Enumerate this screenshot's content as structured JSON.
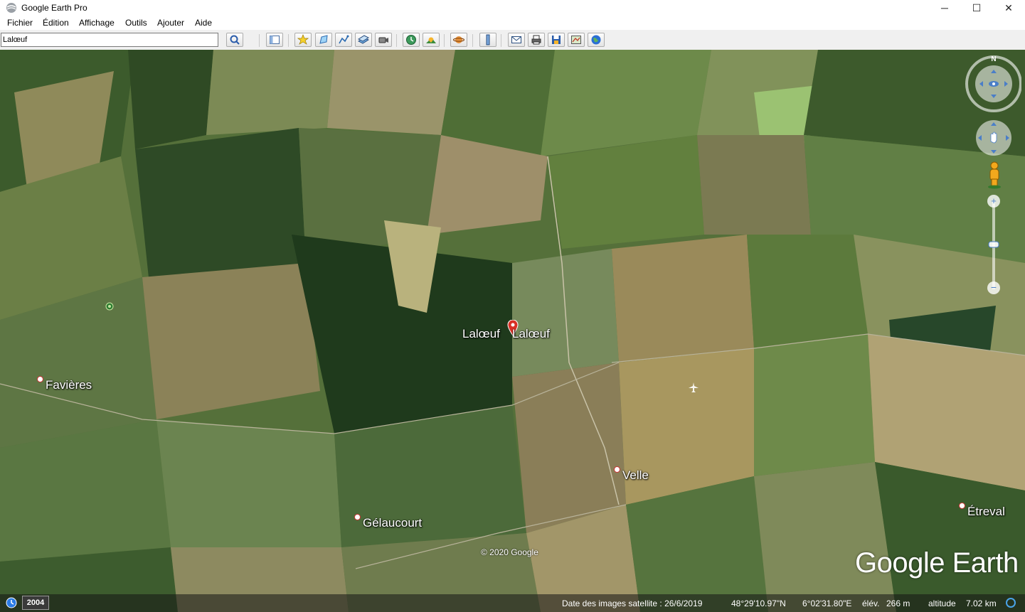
{
  "window": {
    "title": "Google Earth Pro",
    "minimize": "─",
    "maximize": "☐",
    "close": "✕"
  },
  "menu": [
    {
      "label": "Fichier"
    },
    {
      "label": "Édition"
    },
    {
      "label": "Affichage"
    },
    {
      "label": "Outils"
    },
    {
      "label": "Ajouter"
    },
    {
      "label": "Aide"
    }
  ],
  "search": {
    "value": "Lalœuf"
  },
  "toolbar_icons": [
    "search-icon",
    "sidebar-icon",
    "placemark-icon",
    "polygon-icon",
    "path-icon",
    "overlay-icon",
    "tour-icon",
    "history-icon",
    "sunlight-icon",
    "planet-icon",
    "ruler-icon",
    "email-icon",
    "print-icon",
    "save-image-icon",
    "map-view-icon",
    "earth-icon"
  ],
  "places": {
    "laloeuf_1": "Lalœuf",
    "laloeuf_2": "Lalœuf",
    "favieres": "Favières",
    "velle": "Velle",
    "gelaucourt": "Gélaucourt",
    "etreval": "Étreval"
  },
  "map": {
    "copyright": "© 2020 Google",
    "logo": "Google Earth",
    "compass_north": "N"
  },
  "status": {
    "year": "2004",
    "imagery_date": "Date des images satellite : 26/6/2019",
    "latitude": "48°29'10.97\"N",
    "longitude": "6°02'31.80\"E",
    "elevation_label": "élév.",
    "elevation": "266 m",
    "altitude_label": "altitude",
    "altitude": "7.02 km"
  },
  "colors": {
    "accent": "#1a73e8",
    "pin": "#d93025"
  }
}
